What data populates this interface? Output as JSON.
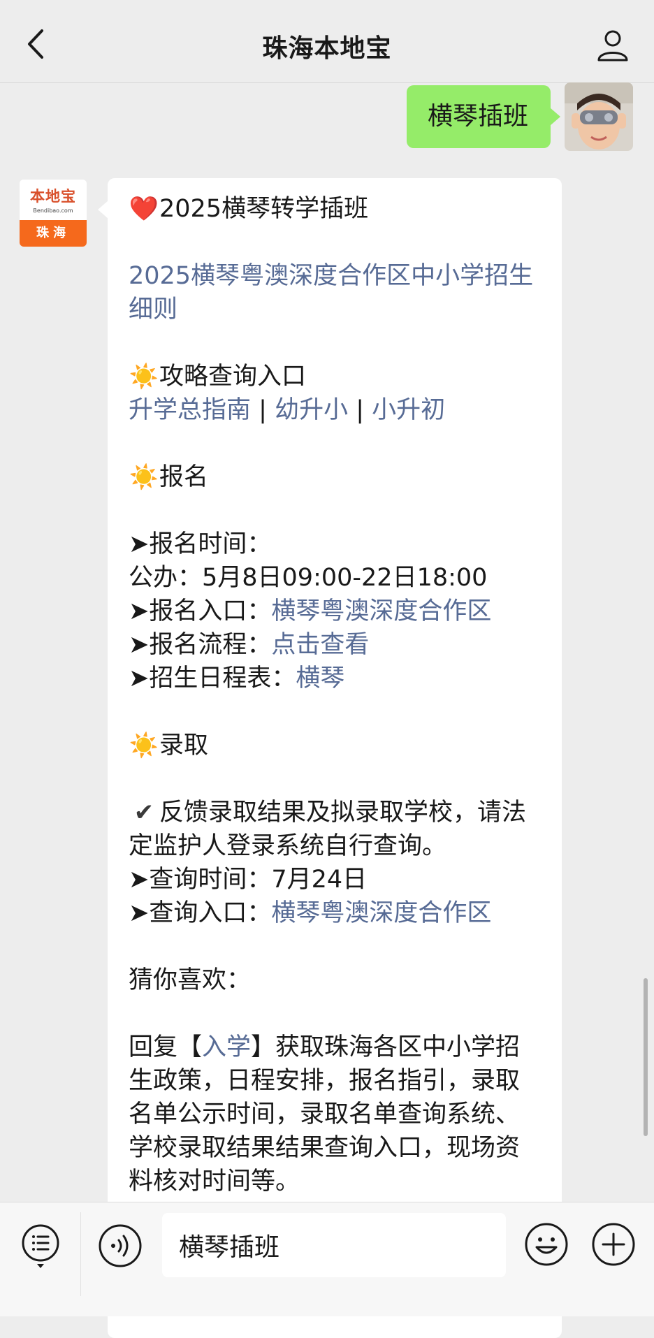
{
  "header": {
    "title": "珠海本地宝"
  },
  "outgoing": {
    "text": "横琴插班"
  },
  "bot": {
    "avatar_top": "本地宝",
    "avatar_domain": "Bendibao.com",
    "avatar_bottom": "珠海"
  },
  "message": {
    "title": "2025横琴转学插班",
    "link_rules": "2025横琴粤澳深度合作区中小学招生细则",
    "guide_heading": "攻略查询入口",
    "guide_links": [
      "升学总指南",
      "幼升小",
      "小升初"
    ],
    "guide_sep": " | ",
    "signup_heading": "报名",
    "signup_time_label": "➤报名时间：",
    "signup_time_value": "公办：5月8日09:00-22日18:00",
    "signup_entry_label": "➤报名入口：",
    "signup_entry_link": "横琴粤澳深度合作区",
    "signup_flow_label": "➤报名流程：",
    "signup_flow_link": "点击查看",
    "schedule_label": "➤招生日程表：",
    "schedule_link": "横琴",
    "admit_heading": "录取",
    "admit_note": "反馈录取结果及拟录取学校，请法定监护人登录系统自行查询。",
    "query_time": "➤查询时间：7月24日",
    "query_entry_label": "➤查询入口：",
    "query_entry_link": "横琴粤澳深度合作区",
    "recommend": "猜你喜欢：",
    "reply_prefix": "回复【",
    "reply_keyword": "入学",
    "reply_suffix": "】获取珠海各区中小学招生政策，日程安排，报名指引，录取名单公示时间，录取名单查询系统、学校录取结果结果查询入口，现场资料核对时间等。",
    "emoji": {
      "heart": "❤️",
      "sun": "☀️",
      "check": "✔"
    }
  },
  "input": {
    "value": "横琴插班"
  },
  "colors": {
    "background": "#ededed",
    "outgoing_bubble": "#95ec69",
    "link": "#576b95",
    "brand_orange": "#f5691c"
  }
}
